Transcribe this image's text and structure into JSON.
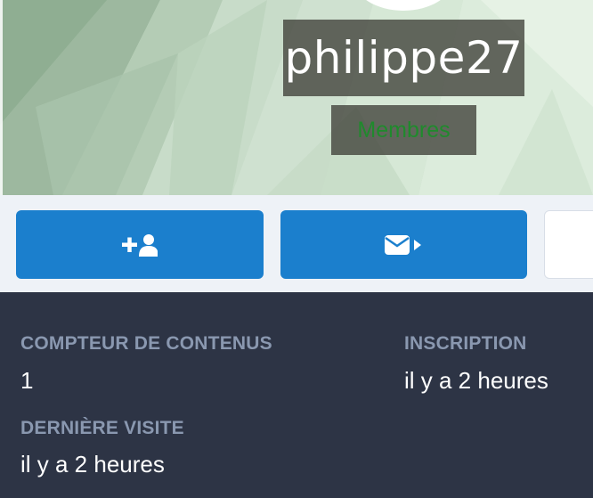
{
  "profile": {
    "username": "philippe27",
    "group": "Membres"
  },
  "actions": {
    "follow_icon": "user-plus-icon",
    "message_icon": "envelope-arrow-icon"
  },
  "stats": {
    "content_count_label": "COMPTEUR DE CONTENUS",
    "content_count_value": "1",
    "joined_label": "INSCRIPTION",
    "joined_value": "il y a 2 heures",
    "last_visit_label": "DERNIÈRE VISITE",
    "last_visit_value": "il y a 2 heures"
  },
  "colors": {
    "primary_button": "#1b7fcd",
    "stats_background": "#2d3445",
    "stat_label": "#8a98b0",
    "group_text": "#1f8a2c"
  }
}
